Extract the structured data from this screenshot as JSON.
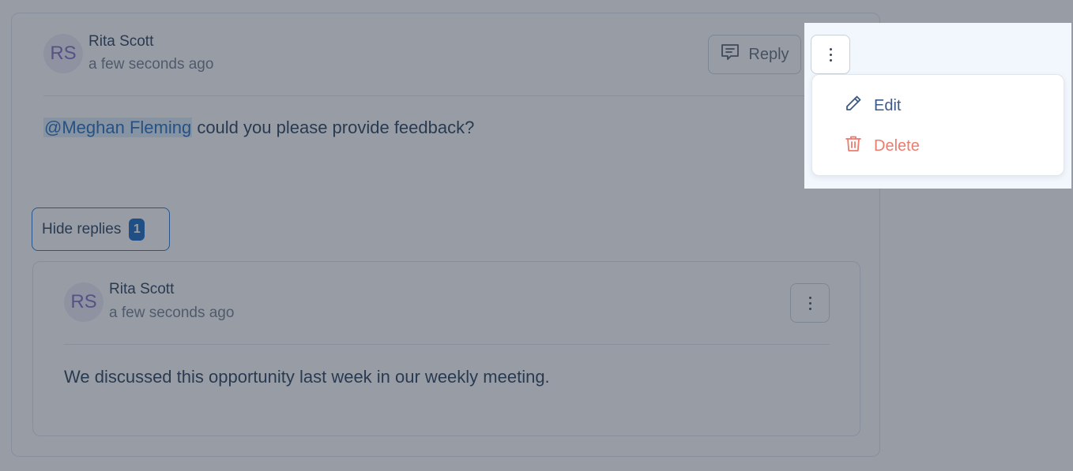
{
  "comment": {
    "avatar_initials": "RS",
    "author": "Rita Scott",
    "time": "a few seconds ago",
    "mention": "@Meghan Fleming",
    "text": " could you please provide feedback?",
    "reply_label": "Reply",
    "hide_replies_label": "Hide replies",
    "reply_count": "1"
  },
  "reply": {
    "avatar_initials": "RS",
    "author": "Rita Scott",
    "time": "a few seconds ago",
    "text": "We discussed this opportunity last week in our weekly meeting."
  },
  "menu": {
    "edit_label": "Edit",
    "delete_label": "Delete"
  },
  "colors": {
    "accent": "#0f62c0",
    "mention_bg": "#dbeaf8",
    "delete": "#ef7b6e",
    "avatar_bg": "#ece9f7",
    "avatar_text": "#7a68bf"
  },
  "icons": {
    "reply": "comment-icon",
    "more": "kebab-icon",
    "edit": "pencil-icon",
    "delete": "trash-icon"
  }
}
